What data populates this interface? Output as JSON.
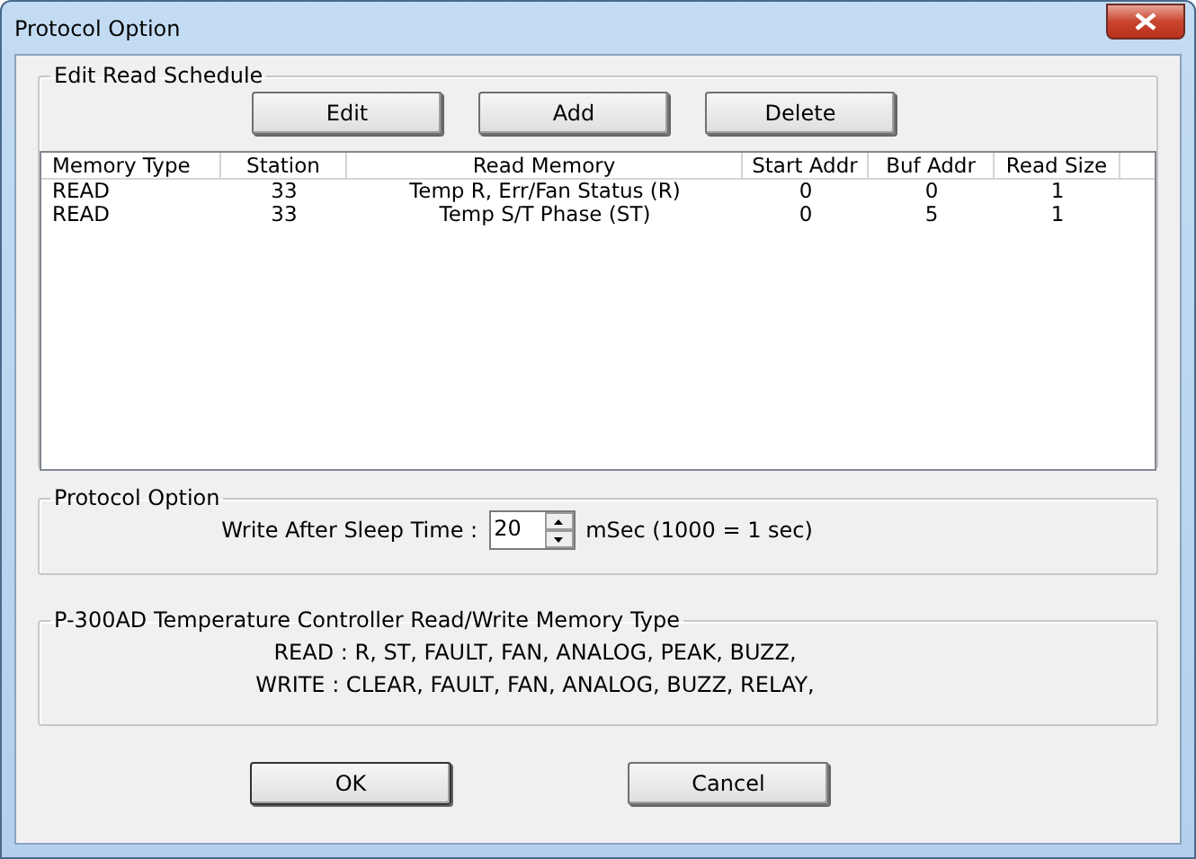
{
  "window": {
    "title": "Protocol Option"
  },
  "schedule": {
    "title": "Edit Read Schedule",
    "buttons": [
      "Edit",
      "Add",
      "Delete"
    ],
    "columns": [
      "Memory Type",
      "Station",
      "Read Memory",
      "Start Addr",
      "Buf Addr",
      "Read Size"
    ],
    "rows": [
      [
        "READ",
        "33",
        "Temp R, Err/Fan Status (R)",
        "0",
        "0",
        "1"
      ],
      [
        "READ",
        "33",
        "Temp S/T Phase (ST)",
        "0",
        "5",
        "1"
      ]
    ]
  },
  "protocol": {
    "title": "Protocol Option",
    "label": "Write After Sleep Time :",
    "value": "20",
    "unit": "mSec (1000 = 1 sec)"
  },
  "memory_types": {
    "title": "P-300AD Temperature Controller Read/Write Memory Type",
    "lines": [
      "READ : R, ST, FAULT, FAN, ANALOG, PEAK, BUZZ,",
      "WRITE : CLEAR, FAULT, FAN, ANALOG, BUZZ, RELAY,"
    ]
  },
  "buttons": [
    "OK",
    "Cancel"
  ]
}
